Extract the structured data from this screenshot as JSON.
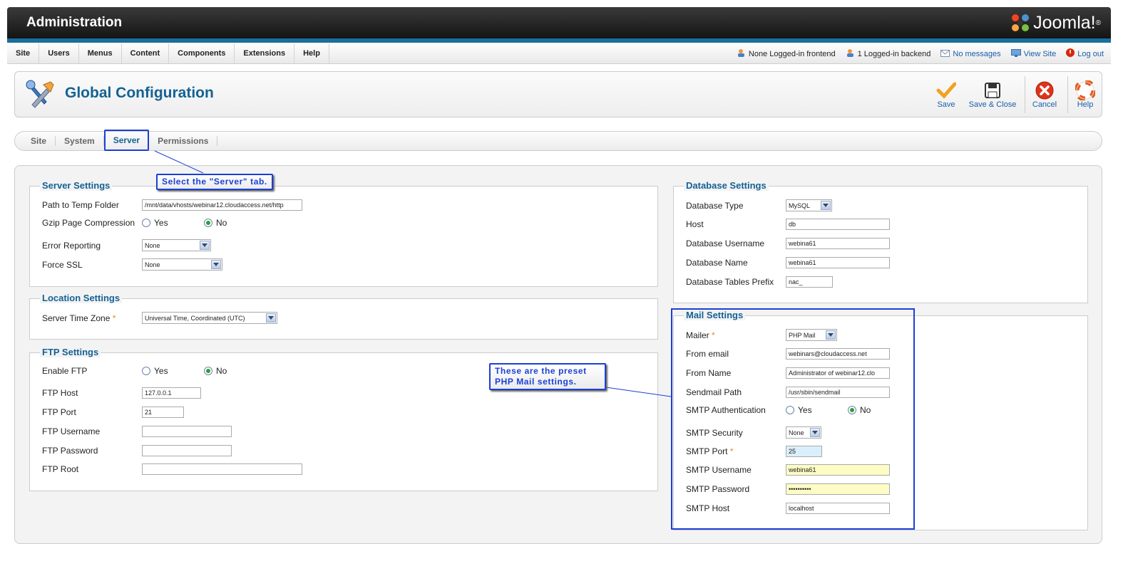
{
  "header": {
    "title": "Administration",
    "logo_text": "Joomla!"
  },
  "menu": [
    "Site",
    "Users",
    "Menus",
    "Content",
    "Components",
    "Extensions",
    "Help"
  ],
  "status": {
    "frontend": "None Logged-in frontend",
    "backend": "1 Logged-in backend",
    "messages": "No messages",
    "view_site": "View Site",
    "logout": "Log out"
  },
  "toolbar": {
    "page_title": "Global Configuration",
    "save": "Save",
    "save_close": "Save & Close",
    "cancel": "Cancel",
    "help": "Help"
  },
  "tabs": [
    "Site",
    "System",
    "Server",
    "Permissions"
  ],
  "callouts": {
    "server_tab": "Select the \"Server\" tab.",
    "mail_line1": "These are the preset",
    "mail_line2": "PHP Mail settings."
  },
  "server_settings": {
    "legend": "Server Settings",
    "temp_label": "Path to Temp Folder",
    "temp_value": "/mnt/data/vhosts/webinar12.cloudaccess.net/http",
    "gzip_label": "Gzip Page Compression",
    "error_label": "Error Reporting",
    "error_value": "None",
    "ssl_label": "Force SSL",
    "ssl_value": "None"
  },
  "location_settings": {
    "legend": "Location Settings",
    "tz_label": "Server Time Zone",
    "tz_value": "Universal Time, Coordinated (UTC)"
  },
  "ftp_settings": {
    "legend": "FTP Settings",
    "enable_label": "Enable FTP",
    "host_label": "FTP Host",
    "host_value": "127.0.0.1",
    "port_label": "FTP Port",
    "port_value": "21",
    "user_label": "FTP Username",
    "pass_label": "FTP Password",
    "root_label": "FTP Root"
  },
  "db_settings": {
    "legend": "Database Settings",
    "type_label": "Database Type",
    "type_value": "MySQL",
    "host_label": "Host",
    "host_value": "db",
    "user_label": "Database Username",
    "user_value": "webina61",
    "name_label": "Database Name",
    "name_value": "webina61",
    "prefix_label": "Database Tables Prefix",
    "prefix_value": "nac_"
  },
  "mail_settings": {
    "legend": "Mail Settings",
    "mailer_label": "Mailer",
    "mailer_value": "PHP Mail",
    "from_email_label": "From email",
    "from_email_value": "webinars@cloudaccess.net",
    "from_name_label": "From Name",
    "from_name_value": "Administrator of webinar12.clo",
    "sendmail_label": "Sendmail Path",
    "sendmail_value": "/usr/sbin/sendmail",
    "smtp_auth_label": "SMTP Authentication",
    "smtp_security_label": "SMTP Security",
    "smtp_security_value": "None",
    "smtp_port_label": "SMTP Port",
    "smtp_port_value": "25",
    "smtp_user_label": "SMTP Username",
    "smtp_user_value": "webina61",
    "smtp_pass_label": "SMTP Password",
    "smtp_pass_value": "••••••••••",
    "smtp_host_label": "SMTP Host",
    "smtp_host_value": "localhost"
  },
  "radio": {
    "yes": "Yes",
    "no": "No"
  },
  "required_mark": "*",
  "colors": {
    "accent": "#146295",
    "highlight": "#1b3fd6",
    "header": "#1a6e9c"
  }
}
